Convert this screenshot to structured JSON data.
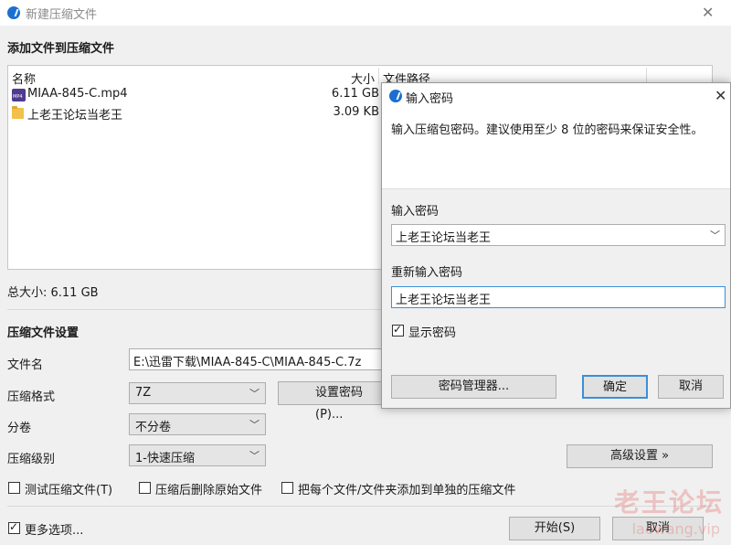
{
  "main_window": {
    "title": "新建压缩文件",
    "add_section_title": "添加文件到压缩文件",
    "columns": {
      "name": "名称",
      "size": "大小",
      "path": "文件路径"
    },
    "files": [
      {
        "name": "MIAA-845-C.mp4",
        "size": "6.11 GB",
        "icon": "mp4-icon"
      },
      {
        "name": "上老王论坛当老王",
        "size": "3.09 KB",
        "icon": "folder-icon"
      }
    ],
    "total_size": "总大小: 6.11 GB",
    "settings_title": "压缩文件设置",
    "filename_label": "文件名",
    "filename_value": "E:\\迅雷下载\\MIAA-845-C\\MIAA-845-C.7z",
    "format_label": "压缩格式",
    "format_value": "7Z",
    "set_password_button": "设置密码(P)...",
    "split_label": "分卷",
    "split_value": "不分卷",
    "level_label": "压缩级别",
    "level_value": "1-快速压缩",
    "advanced_button": "高级设置 »",
    "checks": {
      "test": "测试压缩文件(T)",
      "delete": "压缩后删除原始文件",
      "separate": "把每个文件/文件夹添加到单独的压缩文件",
      "more": "更多选项..."
    },
    "start_button": "开始(S)",
    "cancel_button": "取消"
  },
  "password_dialog": {
    "title": "输入密码",
    "description": "输入压缩包密码。建议使用至少 8 位的密码来保证安全性。",
    "enter_label": "输入密码",
    "enter_value": "上老王论坛当老王",
    "reenter_label": "重新输入密码",
    "reenter_value": "上老王论坛当老王",
    "show_password": "显示密码",
    "manager_button": "密码管理器...",
    "ok_button": "确定",
    "cancel_button": "取消"
  },
  "watermark": {
    "text": "老王论坛",
    "url": "laowang.vip"
  },
  "colors": {
    "accent": "#1c6fd1",
    "focus_border": "#3c8fd8"
  }
}
